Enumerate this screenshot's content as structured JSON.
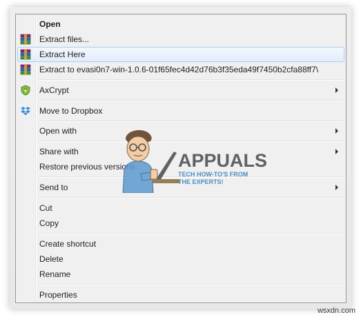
{
  "menu": {
    "items": [
      {
        "label": "Open",
        "icon": "none"
      },
      {
        "label": "Extract files...",
        "icon": "winrar-icon"
      },
      {
        "label": "Extract Here",
        "icon": "winrar-icon"
      },
      {
        "label": "Extract to evasi0n7-win-1.0.6-01f65fec4d42d76b3f35eda49f7450b2cfa88ff7\\",
        "icon": "winrar-icon"
      },
      {
        "label": "AxCrypt",
        "icon": "axcrypt-shield-icon"
      },
      {
        "label": "Move to Dropbox",
        "icon": "dropbox-icon"
      },
      {
        "label": "Open with",
        "icon": "none"
      },
      {
        "label": "Share with",
        "icon": "none"
      },
      {
        "label": "Restore previous versions",
        "icon": "none"
      },
      {
        "label": "Send to",
        "icon": "none"
      },
      {
        "label": "Cut",
        "icon": "none"
      },
      {
        "label": "Copy",
        "icon": "none"
      },
      {
        "label": "Create shortcut",
        "icon": "none"
      },
      {
        "label": "Delete",
        "icon": "none"
      },
      {
        "label": "Rename",
        "icon": "none"
      },
      {
        "label": "Properties",
        "icon": "none"
      }
    ],
    "highlighted_item": "Extract Here",
    "submenu_items": [
      "AxCrypt",
      "Open with",
      "Share with",
      "Send to"
    ]
  },
  "watermark": {
    "title": "APPUALS",
    "subtitle_line1": "TECH HOW-TO'S FROM",
    "subtitle_line2": "THE EXPERTS!"
  },
  "credit": "wsxdn.com",
  "colors": {
    "menu_bg": "#f0f0f0",
    "highlight_border": "#aeccf1",
    "highlight_fill": "#e2edfb",
    "watermark_blue": "#2f7bbd"
  }
}
